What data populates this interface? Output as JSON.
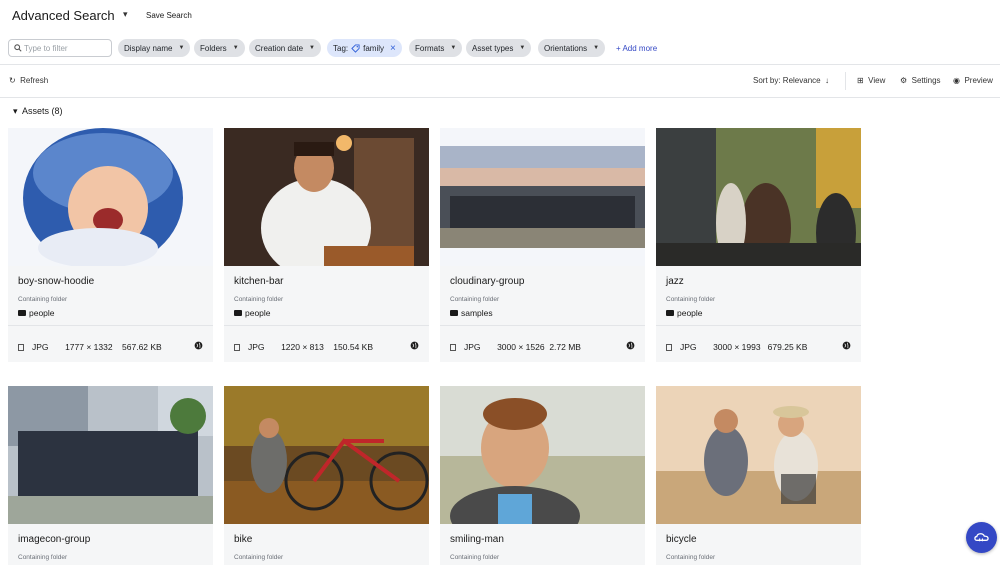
{
  "header": {
    "title": "Advanced Search",
    "save_search": "Save Search"
  },
  "filters": {
    "input_placeholder": "Type to filter",
    "chips": [
      {
        "label": "Display name"
      },
      {
        "label": "Folders"
      },
      {
        "label": "Creation date"
      },
      {
        "label": "Tag:",
        "value": "family",
        "active": true
      },
      {
        "label": "Formats"
      },
      {
        "label": "Asset types"
      },
      {
        "label": "Orientations"
      }
    ],
    "add_more": "+ Add more"
  },
  "toolbar": {
    "refresh": "Refresh",
    "sort": "Sort by: Relevance",
    "view": "View",
    "settings": "Settings",
    "preview": "Preview"
  },
  "assets": {
    "heading": "Assets (8)",
    "folder_label": "Containing folder",
    "items": [
      {
        "name": "boy-snow-hoodie",
        "folder": "people",
        "format": "JPG",
        "dimensions": "1777 × 1332",
        "size": "567.62 KB"
      },
      {
        "name": "kitchen-bar",
        "folder": "people",
        "format": "JPG",
        "dimensions": "1220 × 813",
        "size": "150.54 KB"
      },
      {
        "name": "cloudinary-group",
        "folder": "samples",
        "format": "JPG",
        "dimensions": "3000 × 1526",
        "size": "2.72 MB"
      },
      {
        "name": "jazz",
        "folder": "people",
        "format": "JPG",
        "dimensions": "3000 × 1993",
        "size": "679.25 KB"
      },
      {
        "name": "imagecon-group",
        "folder": "",
        "format": "",
        "dimensions": "",
        "size": ""
      },
      {
        "name": "bike",
        "folder": "",
        "format": "",
        "dimensions": "",
        "size": ""
      },
      {
        "name": "smiling-man",
        "folder": "",
        "format": "",
        "dimensions": "",
        "size": ""
      },
      {
        "name": "bicycle",
        "folder": "",
        "format": "",
        "dimensions": "",
        "size": ""
      }
    ]
  },
  "colors": {
    "accent": "#3448c5",
    "chip_bg": "#dfe1e5",
    "tag_chip_bg": "#dde6fb",
    "card_bg": "#f5f6f7"
  }
}
